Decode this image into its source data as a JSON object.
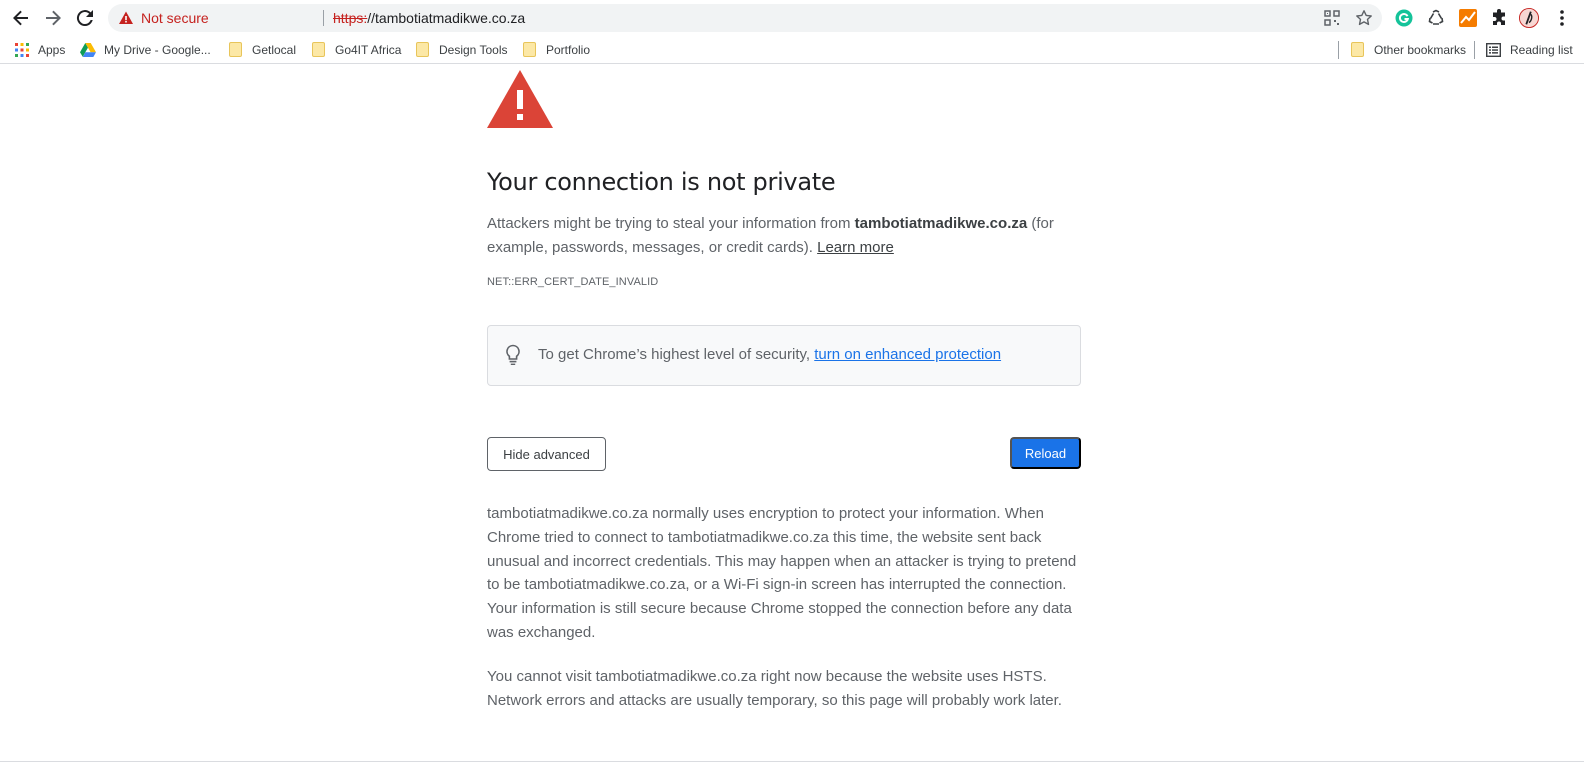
{
  "toolbar": {
    "security_label": "Not secure",
    "url_scheme": "https:",
    "url_rest": "//tambotiatmadikwe.co.za"
  },
  "bookmarks": {
    "apps": "Apps",
    "items": [
      {
        "label": "My Drive - Google...",
        "icon": "google-drive-icon"
      },
      {
        "label": "Getlocal",
        "icon": "folder-icon"
      },
      {
        "label": "Go4IT Africa",
        "icon": "folder-icon"
      },
      {
        "label": "Design Tools",
        "icon": "folder-icon"
      },
      {
        "label": "Portfolio",
        "icon": "folder-icon"
      }
    ],
    "other": "Other bookmarks",
    "reading_list": "Reading list"
  },
  "interstitial": {
    "heading": "Your connection is not private",
    "explanation_prefix": "Attackers might be trying to steal your information from ",
    "domain": "tambotiatmadikwe.co.za",
    "explanation_suffix": " (for example, passwords, messages, or credit cards). ",
    "learn_more": "Learn more",
    "error_code": "NET::ERR_CERT_DATE_INVALID",
    "enhanced_prefix": "To get Chrome’s highest level of security, ",
    "enhanced_link": "turn on enhanced protection",
    "hide_advanced": "Hide advanced",
    "reload": "Reload",
    "details_1": "tambotiatmadikwe.co.za normally uses encryption to protect your information. When Chrome tried to connect to tambotiatmadikwe.co.za this time, the website sent back unusual and incorrect credentials. This may happen when an attacker is trying to pretend to be tambotiatmadikwe.co.za, or a Wi-Fi sign-in screen has interrupted the connection. Your information is still secure because Chrome stopped the connection before any data was exchanged.",
    "details_2": "You cannot visit tambotiatmadikwe.co.za right now because the website uses HSTS. Network errors and attacks are usually temporary, so this page will probably work later."
  },
  "colors": {
    "warning_red": "#db4437",
    "link_blue": "#1a73e8",
    "not_secure_red": "#c5221f"
  }
}
